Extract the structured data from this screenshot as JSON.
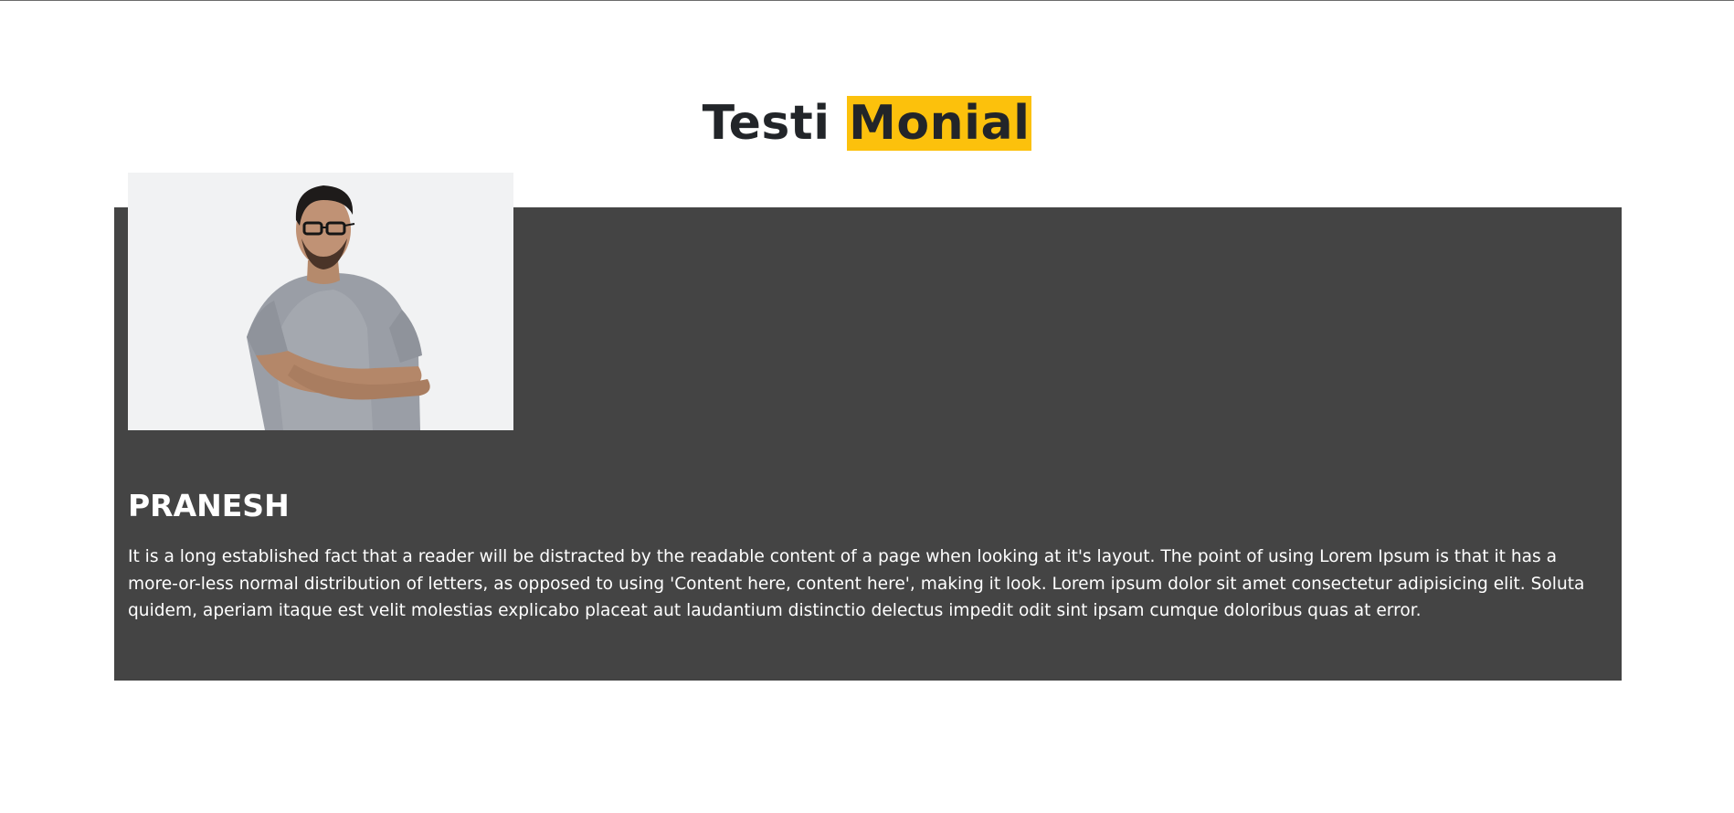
{
  "heading": {
    "part1": "Testi ",
    "part2": "Monial",
    "highlight_color": "#fcc10c"
  },
  "testimonial": {
    "photo_alt": "Man with glasses in grey t-shirt, arms crossed",
    "name": "PRANESH",
    "text": "It is a long established fact that a reader will be distracted by the readable content of a page when looking at it's layout. The point of using Lorem Ipsum is that it has a more-or-less normal distribution of letters, as opposed to using 'Content here, content here', making it look. Lorem ipsum dolor sit amet consectetur adipisicing elit. Soluta quidem, aperiam itaque est velit molestias explicabo placeat aut laudantium distinctio delectus impedit odit sint ipsam cumque doloribus quas at error.",
    "card_color": "#444444"
  }
}
